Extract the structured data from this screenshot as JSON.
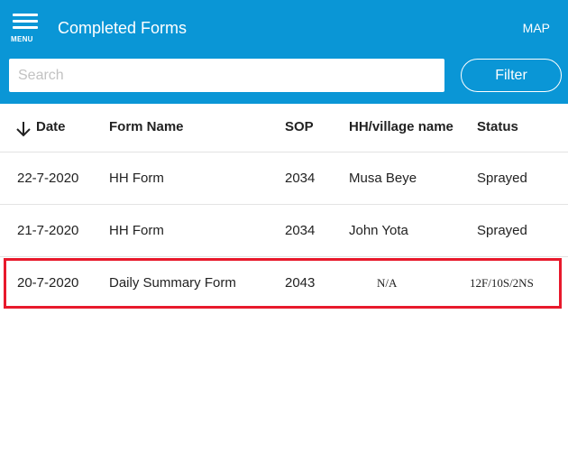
{
  "header": {
    "menu_label": "MENU",
    "title": "Completed Forms",
    "map_label": "MAP"
  },
  "search": {
    "placeholder": "Search",
    "value": ""
  },
  "filter_label": "Filter",
  "table": {
    "columns": {
      "date": "Date",
      "form_name": "Form Name",
      "sop": "SOP",
      "hh_village": "HH/village name",
      "status": "Status"
    },
    "sort_icon": "arrow-down-icon",
    "rows": [
      {
        "date": "22-7-2020",
        "form_name": "HH Form",
        "sop": "2034",
        "hh_village": "Musa Beye",
        "status": "Sprayed"
      },
      {
        "date": "21-7-2020",
        "form_name": "HH Form",
        "sop": "2034",
        "hh_village": "John Yota",
        "status": "Sprayed"
      },
      {
        "date": "20-7-2020",
        "form_name": "Daily Summary Form",
        "sop": "2043",
        "hh_village": "N/A",
        "status": "12F/10S/2NS"
      }
    ]
  },
  "colors": {
    "header_bg": "#0a96d6",
    "highlight": "#e8192c",
    "divider": "#e3e3e3"
  }
}
